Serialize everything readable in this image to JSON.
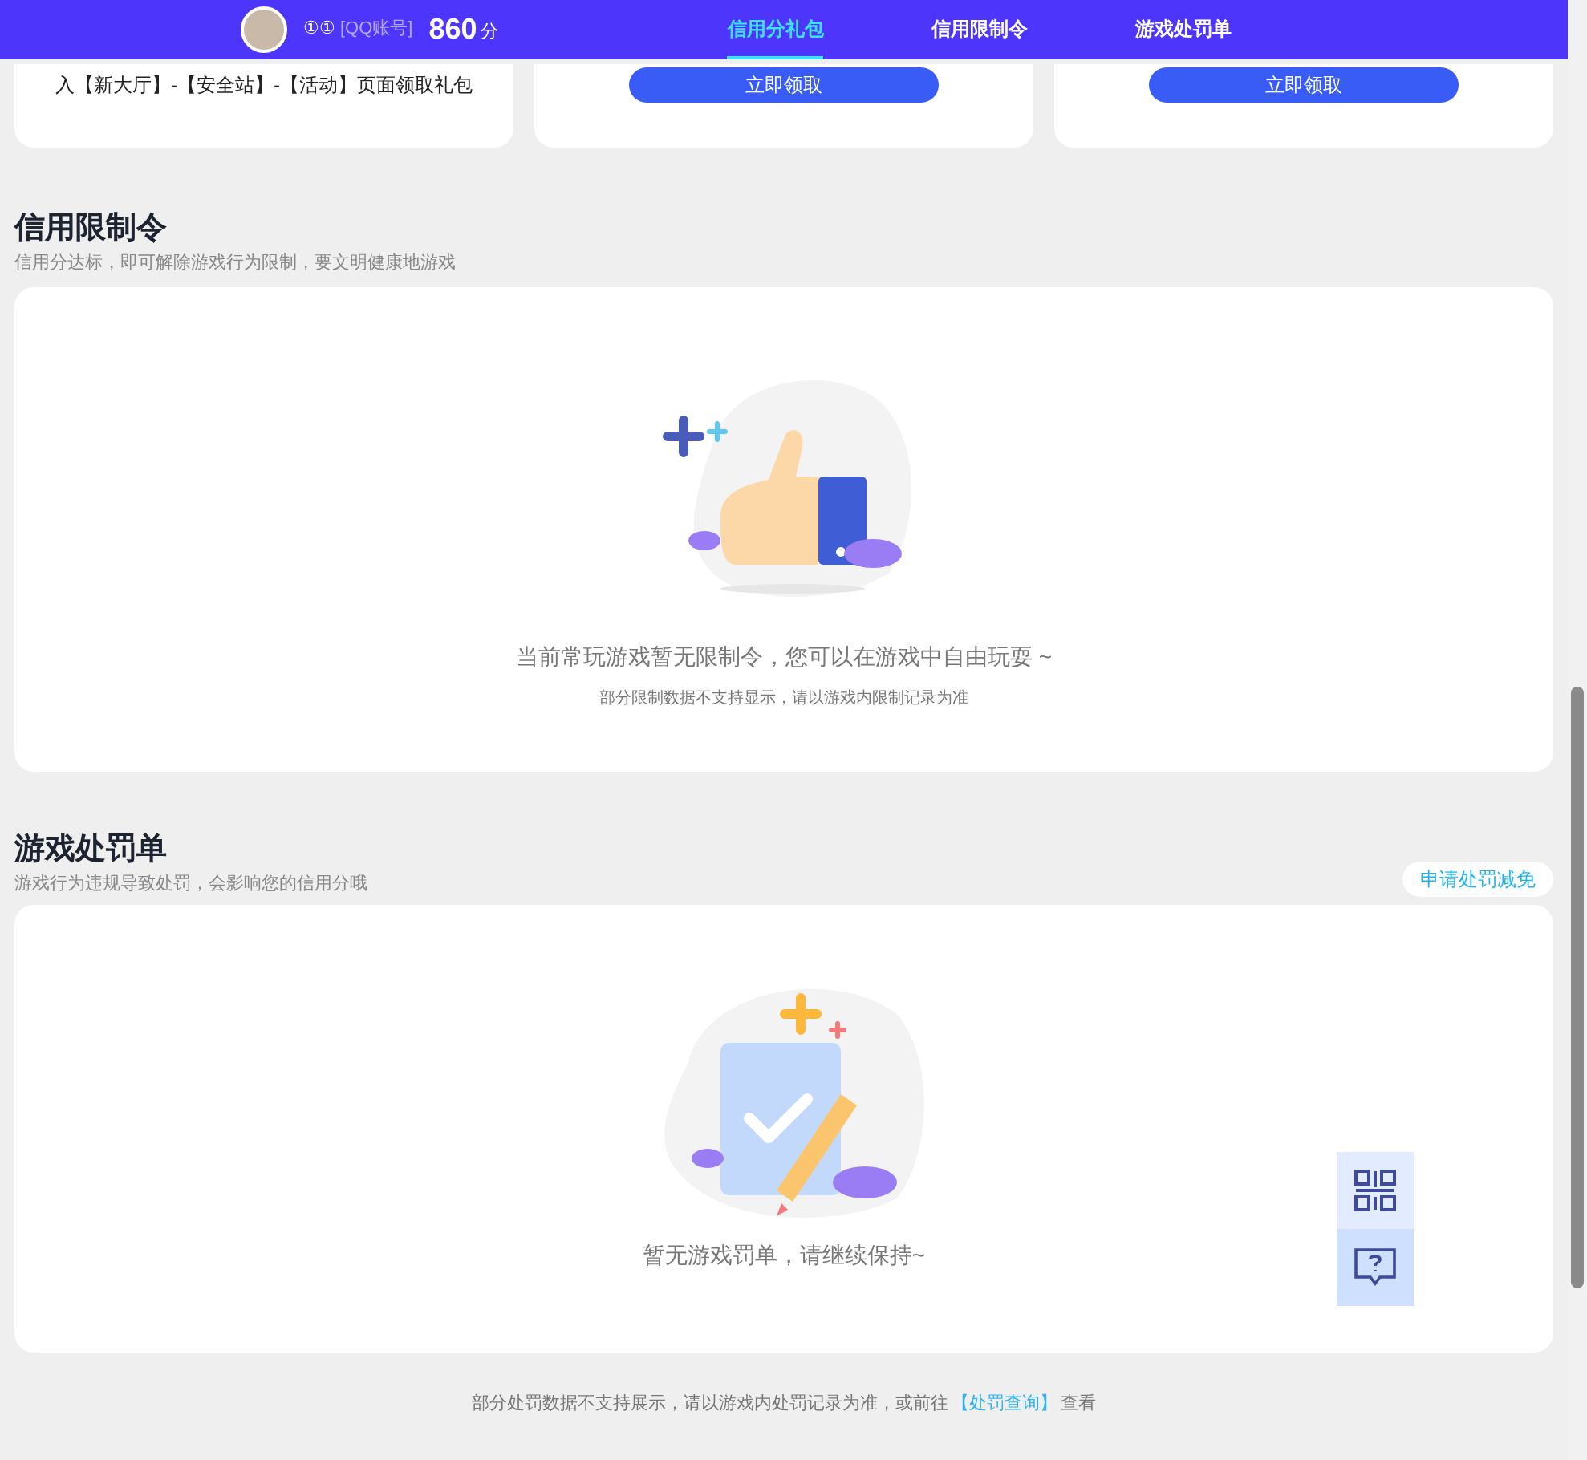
{
  "header": {
    "user_id": "①①",
    "account_label": "[QQ账号]",
    "score": "860",
    "score_unit": "分",
    "tabs": [
      {
        "label": "信用分礼包",
        "selected": true
      },
      {
        "label": "信用限制令",
        "selected": false
      },
      {
        "label": "游戏处罚单",
        "selected": false
      }
    ]
  },
  "gift_cards": [
    {
      "kind": "text",
      "text": "入【新大厅】-【安全站】-【活动】页面领取礼包"
    },
    {
      "kind": "button",
      "button": "立即领取"
    },
    {
      "kind": "button",
      "button": "立即领取"
    }
  ],
  "restriction": {
    "title": "信用限制令",
    "subtitle": "信用分达标，即可解除游戏行为限制，要文明健康地游戏",
    "empty_message": "当前常玩游戏暂无限制令，您可以在游戏中自由玩耍 ~",
    "note": "部分限制数据不支持显示，请以游戏内限制记录为准"
  },
  "penalty": {
    "title": "游戏处罚单",
    "subtitle": "游戏行为违规导致处罚，会影响您的信用分哦",
    "action": "申请处罚减免",
    "empty_message": "暂无游戏罚单，请继续保持~"
  },
  "footer": {
    "text": "部分处罚数据不支持展示，请以游戏内处罚记录为准，或前往",
    "link": "【处罚查询】",
    "suffix": "查看"
  }
}
